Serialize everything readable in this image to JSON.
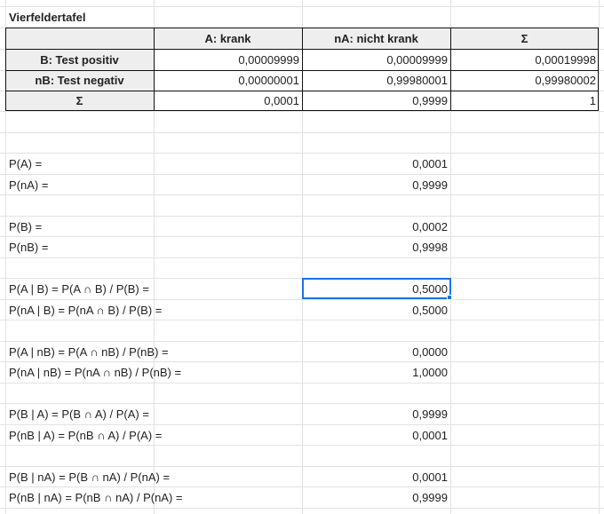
{
  "sheet": {
    "title": "Vierfeldertafel",
    "table": {
      "headers": [
        "",
        "A: krank",
        "nA: nicht krank",
        "Σ"
      ],
      "rows": [
        {
          "label": "B: Test positiv",
          "values": [
            "0,00009999",
            "0,00009999",
            "0,00019998"
          ]
        },
        {
          "label": "nB: Test negativ",
          "values": [
            "0,00000001",
            "0,99980001",
            "0,99980002"
          ]
        },
        {
          "label": "Σ",
          "values": [
            "0,0001",
            "0,9999",
            "1"
          ]
        }
      ]
    },
    "probabilities": [
      {
        "label": "P(A) =",
        "value": "0,0001"
      },
      {
        "label": "P(nA) =",
        "value": "0,9999"
      },
      {
        "label": "P(B) =",
        "value": "0,0002"
      },
      {
        "label": "P(nB) =",
        "value": "0,9998"
      },
      {
        "label": "P(A | B) = P(A ∩ B) / P(B) =",
        "value": "0,5000"
      },
      {
        "label": "P(nA | B) = P(nA ∩ B) / P(B) =",
        "value": "0,5000"
      },
      {
        "label": "P(A | nB) = P(A ∩ nB) / P(nB) =",
        "value": "0,0000"
      },
      {
        "label": "P(nA | nB) = P(nA ∩ nB) / P(nB) =",
        "value": "1,0000"
      },
      {
        "label": "P(B | A) = P(B ∩ A) / P(A) =",
        "value": "0,9999"
      },
      {
        "label": "P(nB | A) = P(nB ∩ A) / P(A) =",
        "value": "0,0001"
      },
      {
        "label": "P(B | nA) = P(B ∩ nA) / P(nA) =",
        "value": "0,0001"
      },
      {
        "label": "P(nB | nA) = P(nB ∩ nA) / P(nA) =",
        "value": "0,9999"
      }
    ]
  },
  "colors": {
    "gridline": "#e2e2e2",
    "header_fill": "#eeeeee",
    "table_border": "#111111",
    "selection": "#1a73e8"
  }
}
